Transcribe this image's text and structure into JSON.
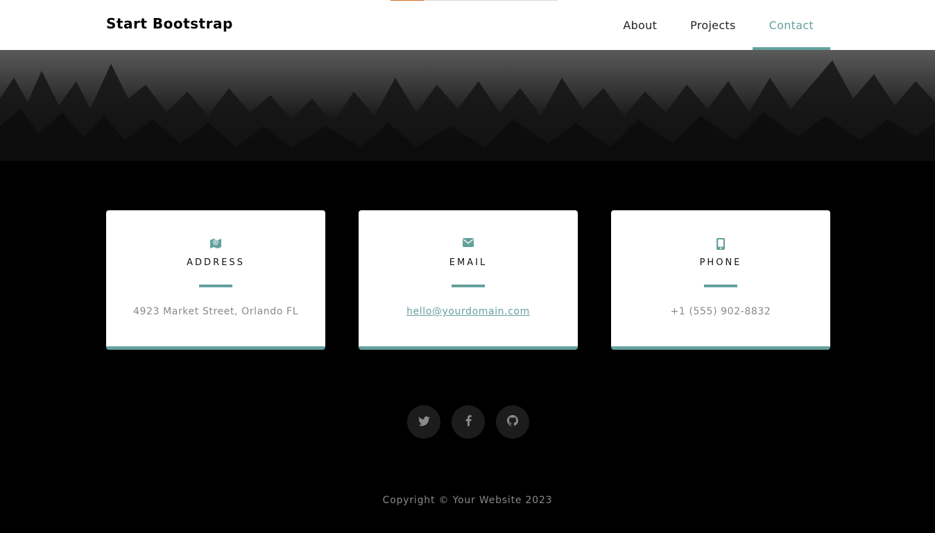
{
  "navbar": {
    "brand": "Start Bootstrap",
    "items": [
      {
        "label": "About",
        "active": false
      },
      {
        "label": "Projects",
        "active": false
      },
      {
        "label": "Contact",
        "active": true
      }
    ]
  },
  "contact": {
    "cards": [
      {
        "icon": "map-icon",
        "title": "ADDRESS",
        "value": "4923 Market Street, Orlando FL"
      },
      {
        "icon": "envelope-icon",
        "title": "EMAIL",
        "value": "hello@yourdomain.com"
      },
      {
        "icon": "mobile-phone-icon",
        "title": "PHONE",
        "value": "+1 (555) 902-8832"
      }
    ]
  },
  "social": {
    "icons": [
      "twitter-icon",
      "facebook-icon",
      "github-icon"
    ]
  },
  "footer": {
    "copyright": "Copyright © Your Website 2023"
  },
  "colors": {
    "accent": "#64a19d",
    "progress": "#d26a1e",
    "background": "#000000"
  }
}
